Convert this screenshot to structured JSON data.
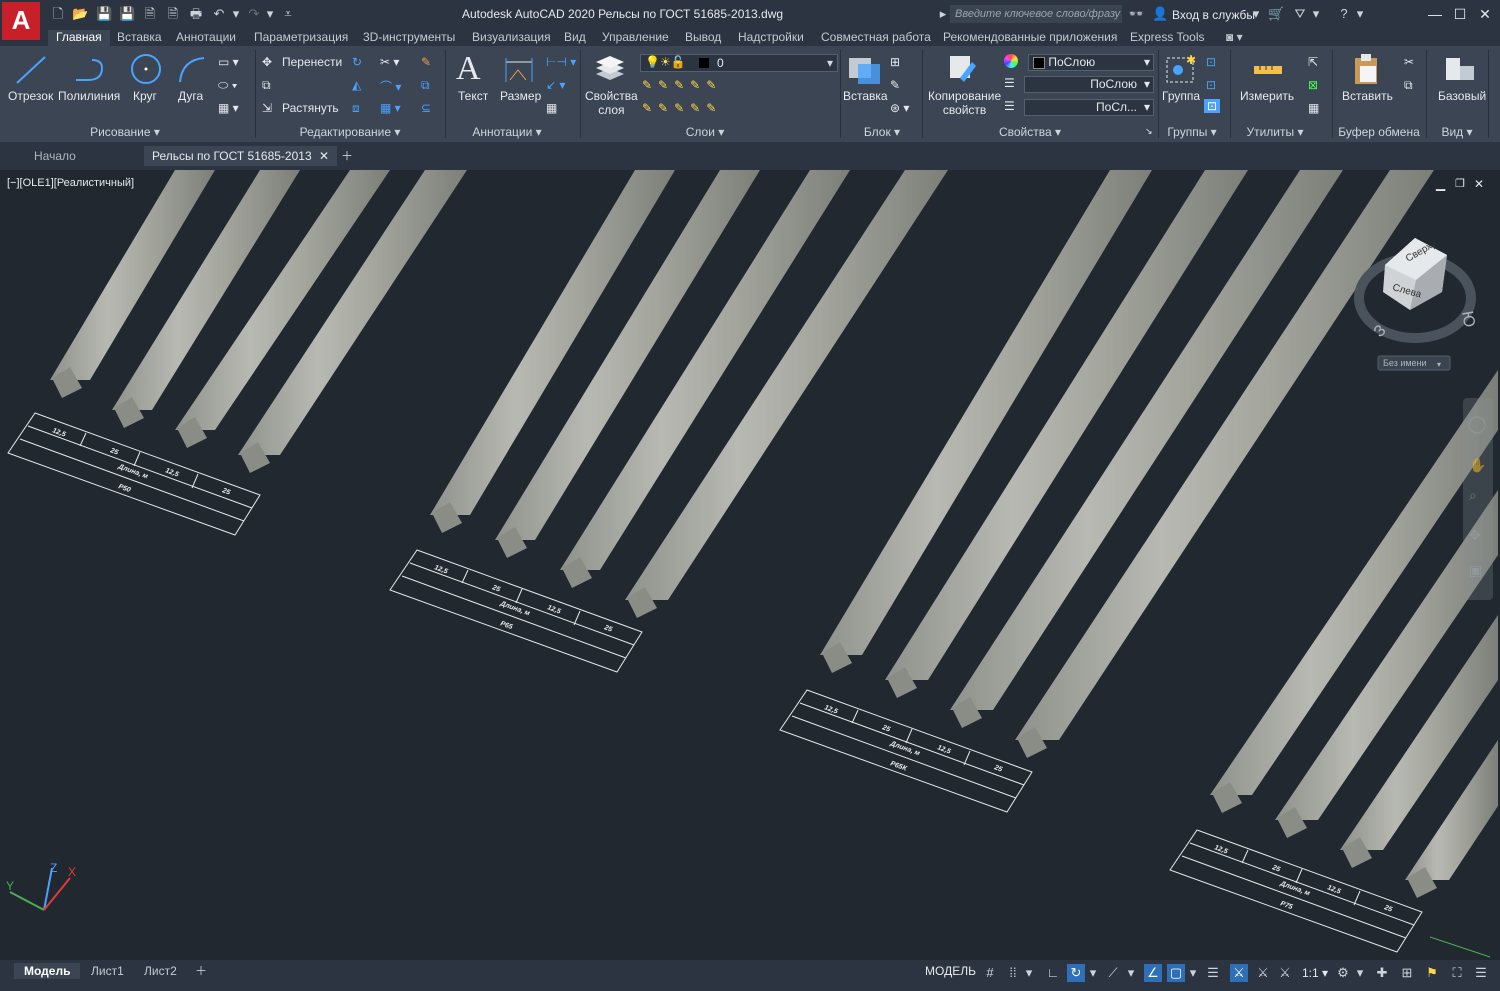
{
  "app": {
    "logo": "A",
    "title": "Autodesk AutoCAD 2020   Рельсы по ГОСТ 51685-2013.dwg"
  },
  "search": {
    "placeholder": "Введите ключевое слово/фразу"
  },
  "login": "Вход в службы",
  "ribbon_tabs": [
    "Главная",
    "Вставка",
    "Аннотации",
    "Параметризация",
    "3D-инструменты",
    "Визуализация",
    "Вид",
    "Управление",
    "Вывод",
    "Надстройки",
    "Совместная работа",
    "Рекомендованные приложения",
    "Express Tools"
  ],
  "draw": {
    "line": "Отрезок",
    "polyline": "Полилиния",
    "circle": "Круг",
    "arc": "Дуга",
    "footer": "Рисование"
  },
  "modify": {
    "move": "Перенести",
    "stretch": "Растянуть",
    "footer": "Редактирование"
  },
  "annotation": {
    "text": "Текст",
    "dim": "Размер",
    "footer": "Аннотации"
  },
  "layers": {
    "props1": "Свойства",
    "props2": "слоя",
    "current": "0",
    "footer": "Слои"
  },
  "block": {
    "insert": "Вставка",
    "footer": "Блок"
  },
  "props": {
    "match1": "Копирование",
    "match2": "свойств",
    "color": "ПоСлою",
    "linetype": "ПоСлою",
    "lineweight": "ПоСл...",
    "footer": "Свойства"
  },
  "groups": {
    "group": "Группа",
    "footer": "Группы"
  },
  "utilities": {
    "measure": "Измерить",
    "footer": "Утилиты"
  },
  "clipboard": {
    "paste": "Вставить",
    "footer": "Буфер обмена"
  },
  "view": {
    "base": "Базовый",
    "footer": "Вид"
  },
  "doc_tabs": [
    "Начало",
    "Рельсы по ГОСТ 51685-2013"
  ],
  "viewport_label": "[−][OLE1][Реалистичный]",
  "viewcube": {
    "top": "Сверху",
    "left": "Слева",
    "west": "З",
    "south": "Ю",
    "ucs": "Без имени"
  },
  "rail_groups": [
    {
      "type": "Р50",
      "c1": "12,5",
      "c2": "25",
      "c3": "12,5",
      "c4": "25",
      "length": "Длина, м"
    },
    {
      "type": "Р65",
      "c1": "12,5",
      "c2": "25",
      "c3": "12,5",
      "c4": "25",
      "length": "Длина, м"
    },
    {
      "type": "Р65К",
      "c1": "12,5",
      "c2": "25",
      "c3": "12,5",
      "c4": "25",
      "length": "Длина, м"
    },
    {
      "type": "Р75",
      "c1": "12,5",
      "c2": "25",
      "c3": "12,5",
      "c4": "25",
      "length": "Длина, м"
    }
  ],
  "layout_tabs": [
    "Модель",
    "Лист1",
    "Лист2"
  ],
  "status": {
    "model": "МОДЕЛЬ",
    "scale": "1:1"
  }
}
